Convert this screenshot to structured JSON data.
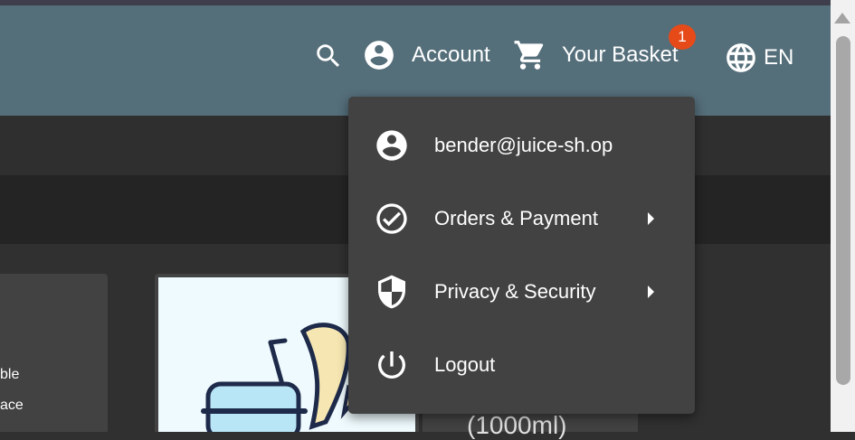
{
  "toolbar": {
    "account_label": "Account",
    "basket_label": "Your Basket",
    "basket_count": "1",
    "language": "EN",
    "colors": {
      "toolbar": "#546e7a",
      "badge": "#e64a19"
    },
    "icons": [
      "search-icon",
      "account-circle-icon",
      "shopping-cart-icon",
      "language-globe-icon"
    ]
  },
  "account_menu": {
    "items": [
      {
        "label": "bender@juice-sh.op",
        "icon": "account-circle-icon",
        "has_submenu": false
      },
      {
        "label": "Orders & Payment",
        "icon": "check-circle-icon",
        "has_submenu": true
      },
      {
        "label": "Privacy & Security",
        "icon": "shield-icon",
        "has_submenu": true
      },
      {
        "label": "Logout",
        "icon": "power-icon",
        "has_submenu": false
      }
    ]
  },
  "background_cards": {
    "left_fragment_line1": "ble",
    "left_fragment_line2": "ace",
    "right_fragment": "(1000ml)"
  }
}
